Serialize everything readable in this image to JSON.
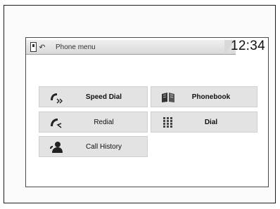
{
  "header": {
    "title": "Phone menu",
    "clock": "12:34",
    "status_icons": [
      "phone-icon",
      "back-icon"
    ]
  },
  "menu": {
    "items": [
      {
        "label": "Speed Dial",
        "icon": "speed-dial-icon"
      },
      {
        "label": "Redial",
        "icon": "redial-icon"
      },
      {
        "label": "Call History",
        "icon": "call-history-icon"
      },
      {
        "label": "Phonebook",
        "icon": "phonebook-icon"
      },
      {
        "label": "Dial",
        "icon": "dial-keypad-icon"
      }
    ]
  }
}
